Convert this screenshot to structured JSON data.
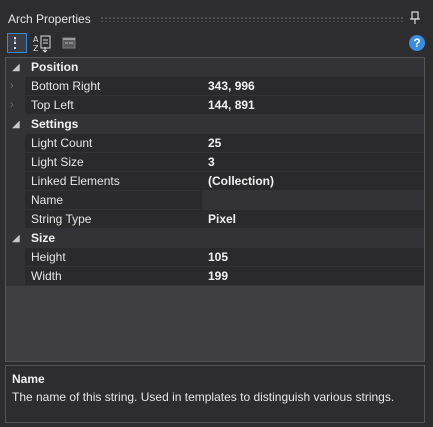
{
  "window": {
    "title": "Arch Properties"
  },
  "toolbar": {
    "categorized_icon": "categorized-icon",
    "alphabetical_icon": "alphabetical-icon",
    "property_pages_icon": "property-pages-icon",
    "help_label": "?"
  },
  "grid": {
    "categories": [
      {
        "label": "Position",
        "props": [
          {
            "name": "Bottom Right",
            "value": "343, 996",
            "expandable": true
          },
          {
            "name": "Top Left",
            "value": "144, 891",
            "expandable": true
          }
        ]
      },
      {
        "label": "Settings",
        "props": [
          {
            "name": "Light Count",
            "value": "25"
          },
          {
            "name": "Light Size",
            "value": "3"
          },
          {
            "name": "Linked Elements",
            "value": "(Collection)"
          },
          {
            "name": "Name",
            "value": ""
          },
          {
            "name": "String Type",
            "value": "Pixel"
          }
        ]
      },
      {
        "label": "Size",
        "props": [
          {
            "name": "Height",
            "value": "105"
          },
          {
            "name": "Width",
            "value": "199"
          }
        ]
      }
    ]
  },
  "description": {
    "title": "Name",
    "text": "The name of this string. Used in templates to distinguish various strings."
  },
  "colors": {
    "accent": "#3d87cc",
    "help": "#3a8ce0",
    "background": "#2d2d30"
  }
}
